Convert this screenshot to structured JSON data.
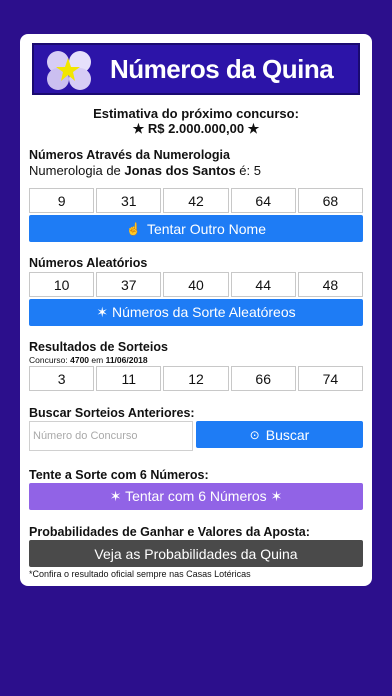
{
  "banner": {
    "title": "Números da Quina"
  },
  "estimate": {
    "label": "Estimativa do próximo concurso:",
    "value": "★ R$ 2.000.000,00 ★"
  },
  "numerology": {
    "heading": "Números Através da Numerologia",
    "prefix": "Numerologia de ",
    "name": "Jonas dos Santos",
    "suffix": " é: 5",
    "numbers": [
      "9",
      "31",
      "42",
      "64",
      "68"
    ],
    "button_icon": "hand-pointer-icon",
    "button_glyph": "☝",
    "button_label": "Tentar Outro Nome"
  },
  "random": {
    "heading": "Números Aleatórios",
    "numbers": [
      "10",
      "37",
      "40",
      "44",
      "48"
    ],
    "button_label": "✶ Números da Sorte Aleatóreos"
  },
  "results": {
    "heading": "Resultados de Sorteios",
    "contest_prefix": "Concurso: ",
    "contest_number": "4700",
    "contest_mid": " em ",
    "contest_date": "11/06/2018",
    "numbers": [
      "3",
      "11",
      "12",
      "66",
      "74"
    ]
  },
  "search": {
    "heading": "Buscar Sorteios Anteriores:",
    "placeholder": "Número do Concurso",
    "button_glyph": "⊙",
    "button_label": "Buscar"
  },
  "six": {
    "heading": "Tente a Sorte com 6 Números:",
    "button_label": "✶ Tentar com 6 Números ✶"
  },
  "probabilities": {
    "heading": "Probabilidades de Ganhar e Valores da Aposta:",
    "button_label": "Veja as Probabilidades da Quina",
    "footnote": "*Confira o resultado oficial sempre nas Casas Lotéricas"
  },
  "colors": {
    "background": "#2c0f8c",
    "blue_button": "#1e7cf5",
    "purple_button": "#9163e6",
    "dark_button": "#4a4a4a"
  }
}
